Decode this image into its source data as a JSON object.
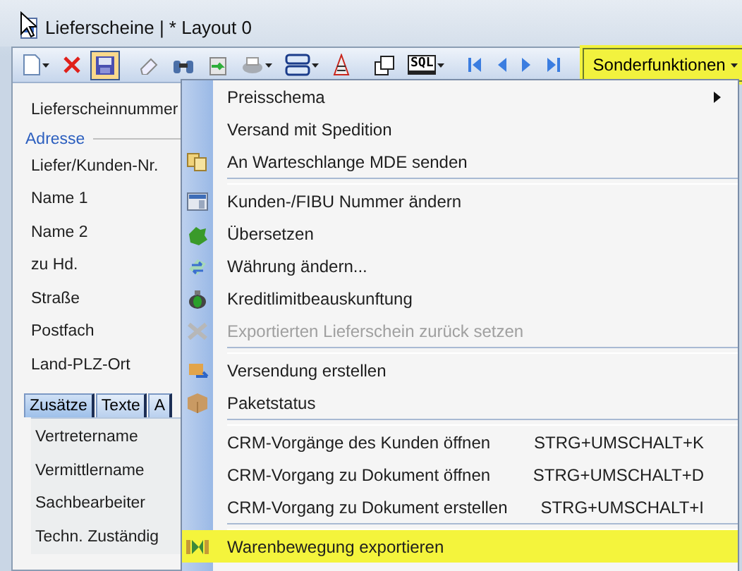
{
  "window": {
    "title": "Lieferscheine | * Layout 0"
  },
  "toolbar": {
    "items": [
      {
        "kind": "new",
        "dropdown": true,
        "selected": false
      },
      {
        "kind": "delete",
        "dropdown": false,
        "selected": false
      },
      {
        "kind": "save",
        "dropdown": false,
        "selected": true
      },
      {
        "kind": "separator"
      },
      {
        "kind": "eraser",
        "dropdown": false,
        "selected": false
      },
      {
        "kind": "find",
        "dropdown": false,
        "selected": false
      },
      {
        "kind": "export",
        "dropdown": false,
        "selected": false
      },
      {
        "kind": "print",
        "dropdown": true,
        "selected": false
      },
      {
        "kind": "stack",
        "dropdown": true,
        "selected": false
      },
      {
        "kind": "document",
        "dropdown": false,
        "selected": false
      },
      {
        "kind": "separator"
      },
      {
        "kind": "copy",
        "dropdown": false,
        "selected": false
      },
      {
        "kind": "sql",
        "label": "SQL",
        "dropdown": true,
        "selected": false
      },
      {
        "kind": "separator"
      },
      {
        "kind": "first",
        "dropdown": false,
        "selected": false
      },
      {
        "kind": "prev",
        "dropdown": false,
        "selected": false
      },
      {
        "kind": "next",
        "dropdown": false,
        "selected": false
      },
      {
        "kind": "last",
        "dropdown": false,
        "selected": false
      },
      {
        "kind": "separator"
      }
    ],
    "special_button": {
      "label": "Sonderfunktionen",
      "pressed": true
    }
  },
  "form": {
    "number_label": "Lieferscheinnummer",
    "address_group": "Adresse",
    "address_fields": [
      "Liefer/Kunden-Nr.",
      "Name 1",
      "Name 2",
      "zu Hd.",
      "Straße",
      "Postfach",
      "Land-PLZ-Ort"
    ],
    "tabs": [
      {
        "label": "Zusätze",
        "selected": true
      },
      {
        "label": "Texte",
        "selected": false
      },
      {
        "label": "A",
        "selected": false
      }
    ],
    "tab_fields": [
      "Vertretername",
      "Vermittlername",
      "Sachbearbeiter",
      "Techn. Zuständig"
    ]
  },
  "menu": {
    "items": [
      {
        "kind": "plain",
        "label": "Preisschema",
        "submenu": true,
        "disabled": false,
        "highlighted": false
      },
      {
        "kind": "plain",
        "label": "Versand mit Spedition",
        "submenu": false,
        "disabled": false,
        "highlighted": false
      },
      {
        "kind": "queue",
        "label": "An Warteschlange MDE senden",
        "submenu": false,
        "disabled": false,
        "highlighted": false
      },
      {
        "kind": "separator"
      },
      {
        "kind": "card",
        "label": "Kunden-/FIBU Nummer ändern",
        "submenu": false,
        "disabled": false,
        "highlighted": false
      },
      {
        "kind": "translate",
        "label": "Übersetzen",
        "submenu": false,
        "disabled": false,
        "highlighted": false
      },
      {
        "kind": "currency",
        "label": "Währung ändern...",
        "submenu": false,
        "disabled": false,
        "highlighted": false
      },
      {
        "kind": "credit",
        "label": "Kreditlimitbeauskunftung",
        "submenu": false,
        "disabled": false,
        "highlighted": false
      },
      {
        "kind": "reset",
        "label": "Exportierten Lieferschein zurück setzen",
        "submenu": false,
        "disabled": true,
        "highlighted": false
      },
      {
        "kind": "separator"
      },
      {
        "kind": "shipping",
        "label": "Versendung erstellen",
        "submenu": false,
        "disabled": false,
        "highlighted": false
      },
      {
        "kind": "package",
        "label": "Paketstatus",
        "submenu": false,
        "disabled": false,
        "highlighted": false
      },
      {
        "kind": "separator"
      },
      {
        "kind": "plain",
        "label": "CRM-Vorgänge des Kunden öffnen",
        "shortcut": "STRG+UMSCHALT+K",
        "submenu": false,
        "disabled": false,
        "highlighted": false
      },
      {
        "kind": "plain",
        "label": "CRM-Vorgang zu Dokument öffnen",
        "shortcut": "STRG+UMSCHALT+D",
        "submenu": false,
        "disabled": false,
        "highlighted": false
      },
      {
        "kind": "plain",
        "label": "CRM-Vorgang zu Dokument erstellen",
        "shortcut": "STRG+UMSCHALT+I",
        "submenu": false,
        "disabled": false,
        "highlighted": false
      },
      {
        "kind": "separator"
      },
      {
        "kind": "export",
        "label": "Warenbewegung exportieren",
        "submenu": false,
        "disabled": false,
        "highlighted": true
      }
    ]
  }
}
